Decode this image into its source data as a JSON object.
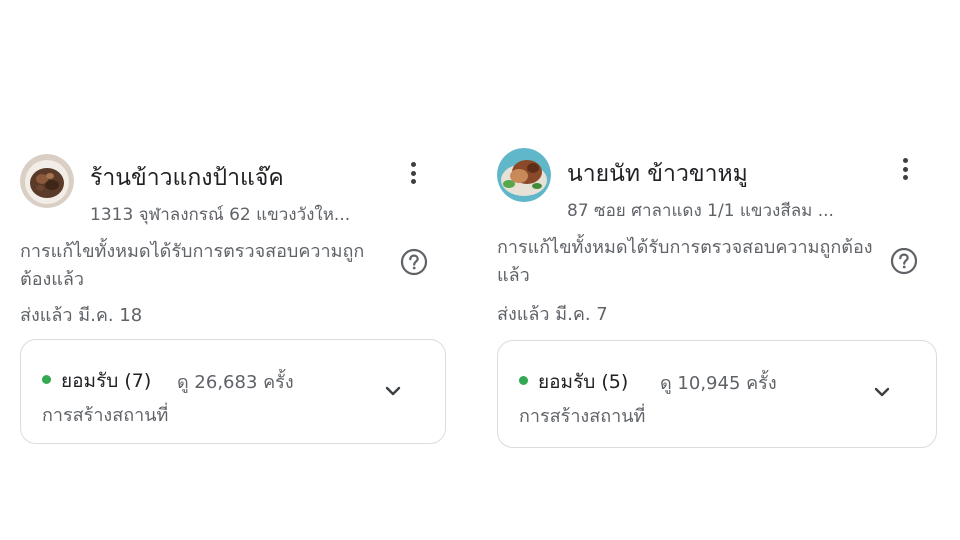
{
  "contributions": [
    {
      "name": "ร้านข้าวแกงป้าแจ๊ค",
      "address": "1313 จุฬาลงกรณ์ 62 แขวงวังให...",
      "status_message": "การแก้ไขทั้งหมดได้รับการตรวจสอบความถูกต้องแล้ว",
      "sent_date": "ส่งแล้ว มี.ค. 18",
      "accepted_label": "ยอมรับ (7)",
      "views": "ดู 26,683 ครั้ง",
      "edit_type": "การสร้างสถานที่",
      "avatar_icon": "food-photo-curry"
    },
    {
      "name": "นายนัท ข้าวขาหมู",
      "address": "87 ซอย ศาลาแดง 1/1 แขวงสีลม ...",
      "status_message": "การแก้ไขทั้งหมดได้รับการตรวจสอบความถูกต้องแล้ว",
      "sent_date": "ส่งแล้ว มี.ค. 7",
      "accepted_label": "ยอมรับ (5)",
      "views": "ดู 10,945 ครั้ง",
      "edit_type": "การสร้างสถานที่",
      "avatar_icon": "food-photo-pork-leg"
    }
  ],
  "colors": {
    "accepted_dot": "#34a853",
    "primary_text": "#202124",
    "secondary_text": "#5f6368",
    "border": "#dadce0"
  }
}
